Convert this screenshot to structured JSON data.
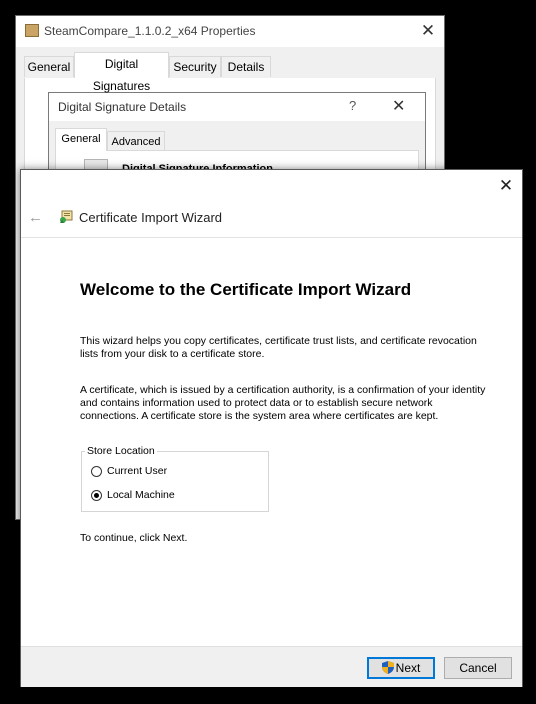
{
  "properties_window": {
    "title": "SteamCompare_1.1.0.2_x64 Properties",
    "close_glyph": "✕",
    "tabs": [
      {
        "label": "General",
        "active": false
      },
      {
        "label": "Digital Signatures",
        "active": true
      },
      {
        "label": "Security",
        "active": false
      },
      {
        "label": "Details",
        "active": false
      }
    ]
  },
  "signature_details_dialog": {
    "title": "Digital Signature Details",
    "help_glyph": "?",
    "close_glyph": "✕",
    "tabs": [
      {
        "label": "General",
        "active": true
      },
      {
        "label": "Advanced",
        "active": false
      }
    ],
    "info_heading": "Digital Signature Information"
  },
  "wizard": {
    "close_glyph": "✕",
    "back_glyph": "←",
    "title": "Certificate Import Wizard",
    "heading": "Welcome to the Certificate Import Wizard",
    "paragraph1": "This wizard helps you copy certificates, certificate trust lists, and certificate revocation lists from your disk to a certificate store.",
    "paragraph2": "A certificate, which is issued by a certification authority, is a confirmation of your identity and contains information used to protect data or to establish secure network connections. A certificate store is the system area where certificates are kept.",
    "store_location": {
      "legend": "Store Location",
      "options": [
        {
          "label": "Current User",
          "selected": false
        },
        {
          "label": "Local Machine",
          "selected": true
        }
      ]
    },
    "continue_text": "To continue, click Next.",
    "buttons": {
      "next": "Next",
      "cancel": "Cancel"
    },
    "colors": {
      "accent": "#0078d7",
      "shield_blue": "#1f5fbf",
      "shield_gold": "#f2b01e"
    }
  }
}
